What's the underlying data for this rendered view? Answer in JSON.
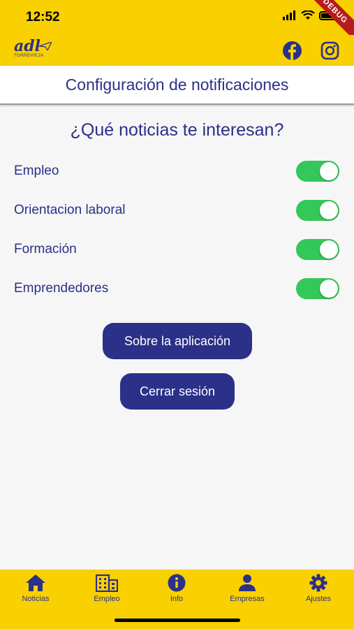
{
  "status_bar": {
    "time": "12:52",
    "ribbon": "DEBUG"
  },
  "header": {
    "logo_text": "adl",
    "logo_sub": "TORREVIEJA",
    "icons": [
      "facebook-icon",
      "instagram-icon"
    ]
  },
  "page": {
    "title": "Configuración de notificaciones",
    "question": "¿Qué noticias te interesan?"
  },
  "settings": [
    {
      "label": "Empleo",
      "enabled": true
    },
    {
      "label": "Orientacion laboral",
      "enabled": true
    },
    {
      "label": "Formación",
      "enabled": true
    },
    {
      "label": "Emprendedores",
      "enabled": true
    }
  ],
  "buttons": {
    "about": "Sobre la aplicación",
    "logout": "Cerrar sesión"
  },
  "nav": [
    {
      "label": "Noticias",
      "icon": "home-icon"
    },
    {
      "label": "Empleo",
      "icon": "building-icon"
    },
    {
      "label": "Info",
      "icon": "info-icon"
    },
    {
      "label": "Empresas",
      "icon": "person-icon"
    },
    {
      "label": "Ajustes",
      "icon": "gear-icon"
    }
  ],
  "colors": {
    "brand_yellow": "#f9d000",
    "brand_blue": "#2b3088",
    "toggle_on": "#34c759",
    "ribbon": "#b71c1c"
  }
}
